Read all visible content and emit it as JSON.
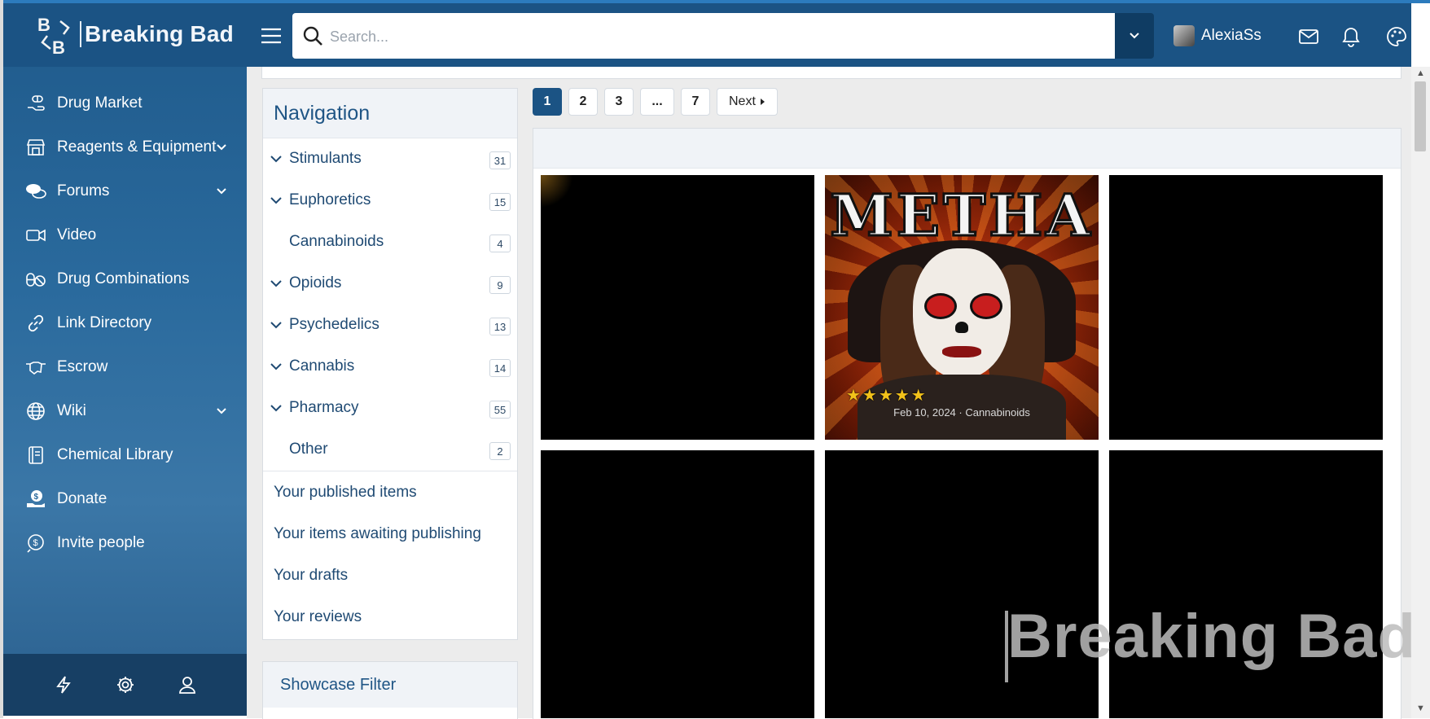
{
  "brand": {
    "name": "Breaking Bad",
    "logo_letters": "B B"
  },
  "sidebar": {
    "items": [
      {
        "label": "Drug Market",
        "icon": "pills-hand-icon",
        "has_chevron": false
      },
      {
        "label": "Reagents & Equipment",
        "icon": "store-icon",
        "has_chevron": true
      },
      {
        "label": "Forums",
        "icon": "comments-icon",
        "has_chevron": true
      },
      {
        "label": "Video",
        "icon": "video-camera-icon",
        "has_chevron": false
      },
      {
        "label": "Drug Combinations",
        "icon": "pill-capsule-icon",
        "has_chevron": false
      },
      {
        "label": "Link Directory",
        "icon": "link-icon",
        "has_chevron": false
      },
      {
        "label": "Escrow",
        "icon": "handshake-icon",
        "has_chevron": false
      },
      {
        "label": "Wiki",
        "icon": "globe-icon",
        "has_chevron": true
      },
      {
        "label": "Chemical Library",
        "icon": "book-icon",
        "has_chevron": false
      },
      {
        "label": "Donate",
        "icon": "donate-hand-icon",
        "has_chevron": false
      },
      {
        "label": "Invite people",
        "icon": "invite-coin-icon",
        "has_chevron": false
      }
    ],
    "footer_icons": [
      "bolt-icon",
      "gear-icon",
      "user-icon"
    ]
  },
  "header": {
    "search_placeholder": "Search...",
    "username": "AlexiaSs",
    "icons": [
      "envelope-icon",
      "bell-icon",
      "palette-icon"
    ]
  },
  "navigation": {
    "title": "Navigation",
    "categories": [
      {
        "name": "Stimulants",
        "count": "31",
        "expandable": true
      },
      {
        "name": "Euphoretics",
        "count": "15",
        "expandable": true
      },
      {
        "name": "Cannabinoids",
        "count": "4",
        "expandable": false
      },
      {
        "name": "Opioids",
        "count": "9",
        "expandable": true
      },
      {
        "name": "Psychedelics",
        "count": "13",
        "expandable": true
      },
      {
        "name": "Cannabis",
        "count": "14",
        "expandable": true
      },
      {
        "name": "Pharmacy",
        "count": "55",
        "expandable": true
      },
      {
        "name": "Other",
        "count": "2",
        "expandable": false
      }
    ],
    "user_links": [
      "Your published items",
      "Your items awaiting publishing",
      "Your drafts",
      "Your reviews"
    ]
  },
  "filter": {
    "title": "Showcase Filter"
  },
  "pagination": {
    "pages": [
      "1",
      "2",
      "3",
      "...",
      "7"
    ],
    "active": "1",
    "next_label": "Next"
  },
  "featured_item": {
    "art_title": "METHA",
    "rating": 5,
    "stars": "★★★★★",
    "meta": "Feb 10, 2024 · Cannabinoids"
  },
  "watermark": "Breaking Bad",
  "colors": {
    "primary": "#1b5384",
    "sidebar": "#2a6a9d",
    "accent_link": "#1f4a73",
    "star": "#f2c21a"
  }
}
